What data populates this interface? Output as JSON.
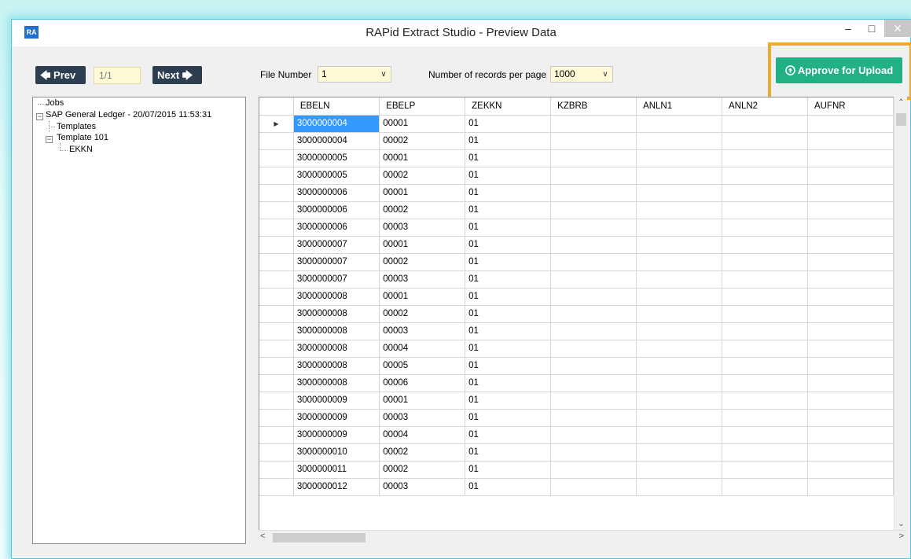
{
  "window": {
    "icon_text": "RA",
    "title": "RAPid Extract Studio - Preview Data",
    "minimize": "–",
    "maximize": "□",
    "close": "✕"
  },
  "toolbar": {
    "prev_label": "🡄 Prev",
    "next_label": "Next 🡆",
    "page_indicator": "1/1",
    "file_number_label": "File Number",
    "file_number_value": "1",
    "records_label": "Number of records per page",
    "records_value": "1000",
    "approve_label": "Approve for Upload",
    "approve_icon": "upload-circle-icon",
    "accent_color": "#22b087",
    "highlight_color": "#f0a830"
  },
  "tree": {
    "root": "Jobs",
    "ledger": "SAP General Ledger - 20/07/2015 11:53:31",
    "templates": "Templates",
    "template": "Template  101",
    "table": "EKKN"
  },
  "grid": {
    "columns": [
      "EBELN",
      "EBELP",
      "ZEKKN",
      "KZBRB",
      "ANLN1",
      "ANLN2",
      "AUFNR"
    ],
    "rows": [
      [
        "3000000004",
        "00001",
        "01",
        "",
        "",
        "",
        ""
      ],
      [
        "3000000004",
        "00002",
        "01",
        "",
        "",
        "",
        ""
      ],
      [
        "3000000005",
        "00001",
        "01",
        "",
        "",
        "",
        ""
      ],
      [
        "3000000005",
        "00002",
        "01",
        "",
        "",
        "",
        ""
      ],
      [
        "3000000006",
        "00001",
        "01",
        "",
        "",
        "",
        ""
      ],
      [
        "3000000006",
        "00002",
        "01",
        "",
        "",
        "",
        ""
      ],
      [
        "3000000006",
        "00003",
        "01",
        "",
        "",
        "",
        ""
      ],
      [
        "3000000007",
        "00001",
        "01",
        "",
        "",
        "",
        ""
      ],
      [
        "3000000007",
        "00002",
        "01",
        "",
        "",
        "",
        ""
      ],
      [
        "3000000007",
        "00003",
        "01",
        "",
        "",
        "",
        ""
      ],
      [
        "3000000008",
        "00001",
        "01",
        "",
        "",
        "",
        ""
      ],
      [
        "3000000008",
        "00002",
        "01",
        "",
        "",
        "",
        ""
      ],
      [
        "3000000008",
        "00003",
        "01",
        "",
        "",
        "",
        ""
      ],
      [
        "3000000008",
        "00004",
        "01",
        "",
        "",
        "",
        ""
      ],
      [
        "3000000008",
        "00005",
        "01",
        "",
        "",
        "",
        ""
      ],
      [
        "3000000008",
        "00006",
        "01",
        "",
        "",
        "",
        ""
      ],
      [
        "3000000009",
        "00001",
        "01",
        "",
        "",
        "",
        ""
      ],
      [
        "3000000009",
        "00003",
        "01",
        "",
        "",
        "",
        ""
      ],
      [
        "3000000009",
        "00004",
        "01",
        "",
        "",
        "",
        ""
      ],
      [
        "3000000010",
        "00002",
        "01",
        "",
        "",
        "",
        ""
      ],
      [
        "3000000011",
        "00002",
        "01",
        "",
        "",
        "",
        ""
      ],
      [
        "3000000012",
        "00003",
        "01",
        "",
        "",
        "",
        ""
      ]
    ],
    "selected_row": 0,
    "current_row_marker": "▶"
  }
}
